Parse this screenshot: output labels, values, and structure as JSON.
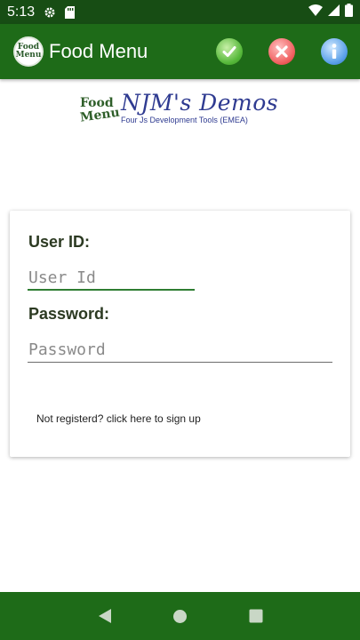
{
  "status_bar": {
    "time": "5:13",
    "icons": [
      "settings-icon",
      "sd-card-icon",
      "wifi-icon",
      "signal-icon",
      "battery-icon"
    ]
  },
  "app_bar": {
    "logo_text_top": "Food",
    "logo_text_bottom": "Menu",
    "title": "Food Menu",
    "actions": [
      {
        "name": "accept",
        "icon": "check-icon"
      },
      {
        "name": "cancel",
        "icon": "close-icon"
      },
      {
        "name": "info",
        "icon": "info-icon"
      }
    ]
  },
  "branding": {
    "mark_top": "Food",
    "mark_bottom": "Menu",
    "title": "NJM's Demos",
    "subtitle": "Four Js Development Tools (EMEA)"
  },
  "login": {
    "userid_label": "User ID:",
    "userid_value": "",
    "userid_placeholder": "User Id",
    "password_label": "Password:",
    "password_value": "",
    "password_placeholder": "Password",
    "signup_text": "Not registerd? click here to sign up"
  },
  "nav_bar": {
    "buttons": [
      "back-icon",
      "home-icon",
      "recents-icon"
    ]
  },
  "colors": {
    "status_bar": "#174d14",
    "app_bar": "#1e6b18",
    "nav_bar": "#1e6b18",
    "brand_text": "#2f3b91",
    "input_focus": "#2e7d32"
  }
}
